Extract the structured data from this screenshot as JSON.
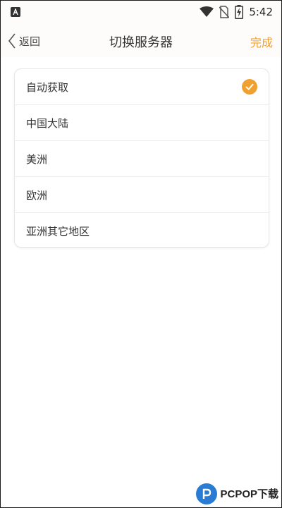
{
  "status_bar": {
    "time": "5:42",
    "icons": [
      "app-a-icon",
      "wifi-icon",
      "no-sim-icon",
      "battery-charging-icon"
    ]
  },
  "nav": {
    "back_label": "返回",
    "title": "切换服务器",
    "done_label": "完成",
    "accent_color": "#f0a030"
  },
  "servers": [
    {
      "label": "自动获取",
      "selected": true
    },
    {
      "label": "中国大陆",
      "selected": false
    },
    {
      "label": "美洲",
      "selected": false
    },
    {
      "label": "欧洲",
      "selected": false
    },
    {
      "label": "亚洲其它地区",
      "selected": false
    }
  ],
  "watermark": {
    "text": "PCPOP下载"
  }
}
